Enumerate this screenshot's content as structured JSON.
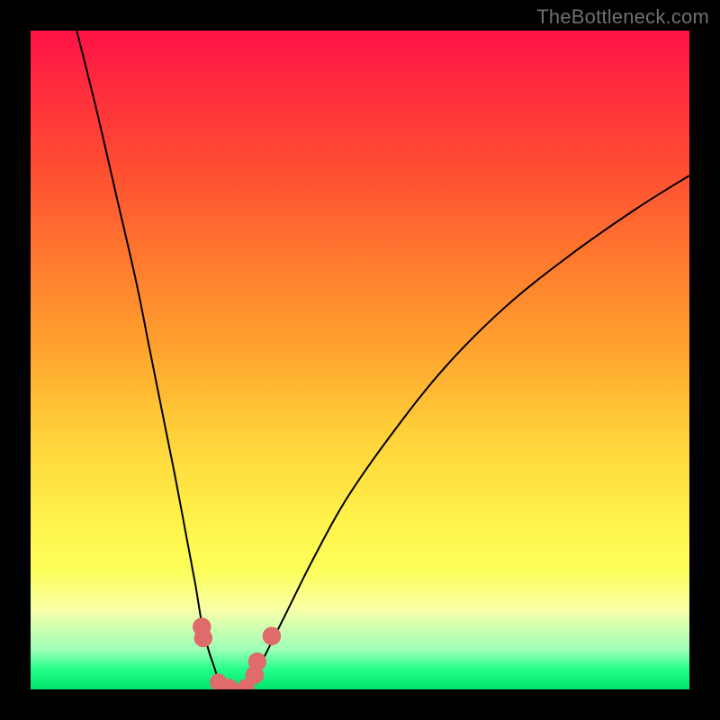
{
  "watermark": "TheBottleneck.com",
  "chart_data": {
    "type": "line",
    "title": "",
    "xlabel": "",
    "ylabel": "",
    "xlim": [
      0,
      100
    ],
    "ylim": [
      0,
      100
    ],
    "grid": false,
    "legend": null,
    "series": [
      {
        "name": "left-curve",
        "x": [
          7,
          10,
          13,
          16,
          18,
          20,
          22,
          23.5,
          25,
          26,
          27,
          28,
          28.5,
          29
        ],
        "values": [
          100,
          88,
          75,
          62,
          52,
          42,
          32,
          24,
          16,
          10,
          6,
          3,
          1.2,
          0.2
        ]
      },
      {
        "name": "right-curve",
        "x": [
          33,
          34,
          36,
          39,
          43,
          48,
          55,
          63,
          72,
          82,
          92,
          100
        ],
        "values": [
          0.2,
          2,
          6,
          12,
          20,
          29,
          39,
          49,
          58,
          66,
          73,
          78
        ]
      }
    ],
    "markers": [
      {
        "x": 26.0,
        "y": 9.5,
        "r": 1.4
      },
      {
        "x": 26.2,
        "y": 7.8,
        "r": 1.4
      },
      {
        "x": 28.5,
        "y": 1.1,
        "r": 1.3
      },
      {
        "x": 30.2,
        "y": 0.3,
        "r": 1.3
      },
      {
        "x": 32.7,
        "y": 0.3,
        "r": 1.3
      },
      {
        "x": 34.0,
        "y": 2.2,
        "r": 1.4
      },
      {
        "x": 34.4,
        "y": 4.2,
        "r": 1.4
      },
      {
        "x": 36.6,
        "y": 8.1,
        "r": 1.4
      }
    ],
    "baseline_y": 0.0,
    "colors": {
      "curve": "#000000",
      "marker": "#e06b6b"
    }
  }
}
